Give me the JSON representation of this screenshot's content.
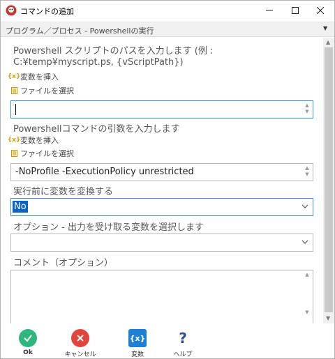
{
  "window": {
    "title": "コマンドの追加",
    "minimize_glyph": "—",
    "maximize_glyph": "☐",
    "close_glyph": "✕"
  },
  "section": {
    "title": "プログラム／プロセス - Powershellの実行"
  },
  "script_path": {
    "label_line1": "Powershell スクリプトのパスを入力します (例 :",
    "label_line2": "C:¥temp¥myscript.ps, {vScriptPath})",
    "insert_variable": "変数を挿入",
    "select_file": "ファイルを選択",
    "value": ""
  },
  "arguments": {
    "label": "Powershellコマンドの引数を入力します",
    "insert_variable": "変数を挿入",
    "select_file": "ファイルを選択",
    "value": "-NoProfile -ExecutionPolicy unrestricted"
  },
  "convert_variables": {
    "label": "実行前に変数を変換する",
    "selected": "No"
  },
  "output_variable": {
    "label": "オプション - 出力を受け取る変数を選択します",
    "selected": ""
  },
  "comment": {
    "label": "コメント（オプション）",
    "value": ""
  },
  "toolbar": {
    "ok_label": "Ok",
    "cancel_label": "キャンセル",
    "variable_label": "変数",
    "help_label": "ヘルプ",
    "variable_glyph": "{x}",
    "help_glyph": "?"
  },
  "colors": {
    "ok": "#2fb67c",
    "cancel": "#e0443a",
    "variable": "#1e7fd6",
    "help": "#2a4f8f",
    "selection": "#0a64c8",
    "focus_border": "#3f8ed8"
  },
  "icons": [
    "app-logo-icon",
    "insert-variable-icon",
    "file-icon",
    "check-icon",
    "cross-icon",
    "variable-icon",
    "help-icon",
    "chevron-down-icon"
  ]
}
